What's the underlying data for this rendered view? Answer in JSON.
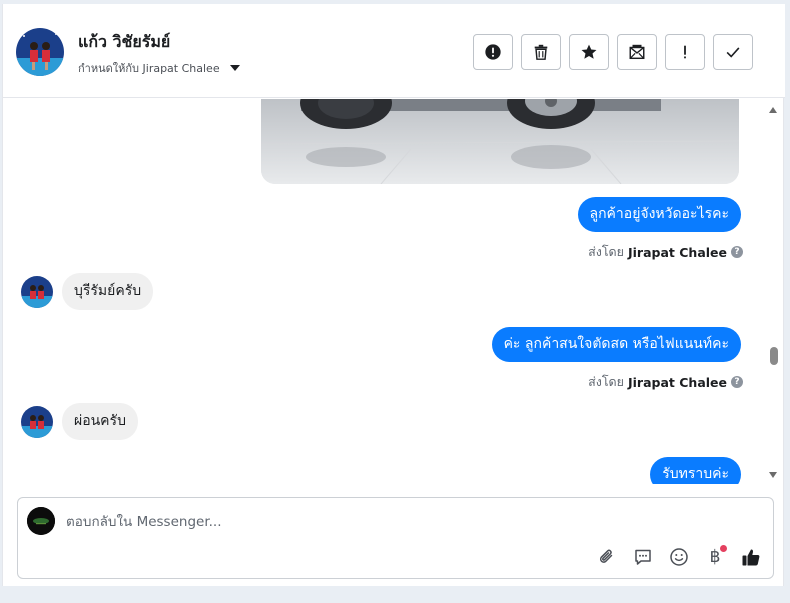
{
  "header": {
    "contact_name": "แก้ว วิชัยรัมย์",
    "assign_label": "กำหนดให้กับ Jirapat Chalee",
    "toolbar": [
      {
        "name": "report-button",
        "icon": "alert-circle-icon"
      },
      {
        "name": "delete-button",
        "icon": "trash-icon"
      },
      {
        "name": "star-button",
        "icon": "star-icon"
      },
      {
        "name": "mark-unread-button",
        "icon": "envelope-icon"
      },
      {
        "name": "follow-up-button",
        "icon": "exclamation-icon"
      },
      {
        "name": "mark-done-button",
        "icon": "check-icon"
      }
    ]
  },
  "messages": [
    {
      "type": "image",
      "from": "page"
    },
    {
      "type": "text",
      "from": "page",
      "text": "ลูกค้าอยู่จังหวัดอะไรคะ",
      "sent_by_prefix": "ส่งโดย",
      "sent_by_name": "Jirapat Chalee"
    },
    {
      "type": "text",
      "from": "customer",
      "text": "บุรีรัมย์ครับ"
    },
    {
      "type": "text",
      "from": "page",
      "text": "ค่ะ ลูกค้าสนใจตัดสด หรือไฟแนนท์คะ",
      "sent_by_prefix": "ส่งโดย",
      "sent_by_name": "Jirapat Chalee"
    },
    {
      "type": "text",
      "from": "customer",
      "text": "ผ่อนครับ"
    },
    {
      "type": "text",
      "from": "page",
      "text": "รับทราบค่ะ"
    }
  ],
  "composer": {
    "placeholder": "ตอบกลับใน Messenger...",
    "actions": [
      "paperclip-icon",
      "saved-reply-icon",
      "emoji-icon",
      "baht-payment-icon",
      "thumbs-up-icon"
    ],
    "baht_symbol": "฿"
  },
  "colors": {
    "outgoing_bubble": "#0a7cff",
    "incoming_bubble": "#f0f0f0",
    "notification_dot": "#e4405f"
  }
}
